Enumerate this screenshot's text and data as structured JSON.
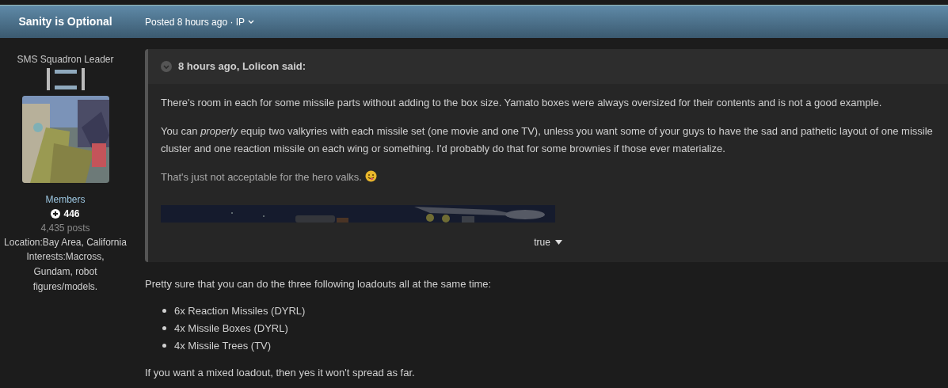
{
  "header": {
    "author": "Sanity is Optional",
    "meta": "Posted 8 hours ago · IP"
  },
  "profile": {
    "rank": "SMS Squadron Leader",
    "group": "Members",
    "reputation": "446",
    "posts": "4,435 posts",
    "location": "Location:Bay Area, California",
    "interests": "Interests:Macross, Gundam, robot figures/models."
  },
  "quote": {
    "citation": "8 hours ago, Lolicon said:",
    "paragraphs": [
      "There's room in each for some missile parts without adding to the box size. Yamato boxes were always oversized for their contents and is not a good example.",
      "You can *properly* equip two valkyries with each missile set (one movie and one TV), unless you want some of your guys to have the sad and pathetic layout of one missile cluster and one reaction missile on each wing or something. I'd probably do that for some brownies if those ever materialize.",
      "That's just not acceptable for the hero valks."
    ],
    "expand_label": "true"
  },
  "body": {
    "intro": "Pretty sure that you can do the three following loadouts all at the same time:",
    "list": [
      "6x Reaction Missiles (DYRL)",
      "4x Missile Boxes (DYRL)",
      "4x Missile Trees (TV)"
    ],
    "outro": "If you want a mixed loadout, then yes it won't spread as far."
  }
}
